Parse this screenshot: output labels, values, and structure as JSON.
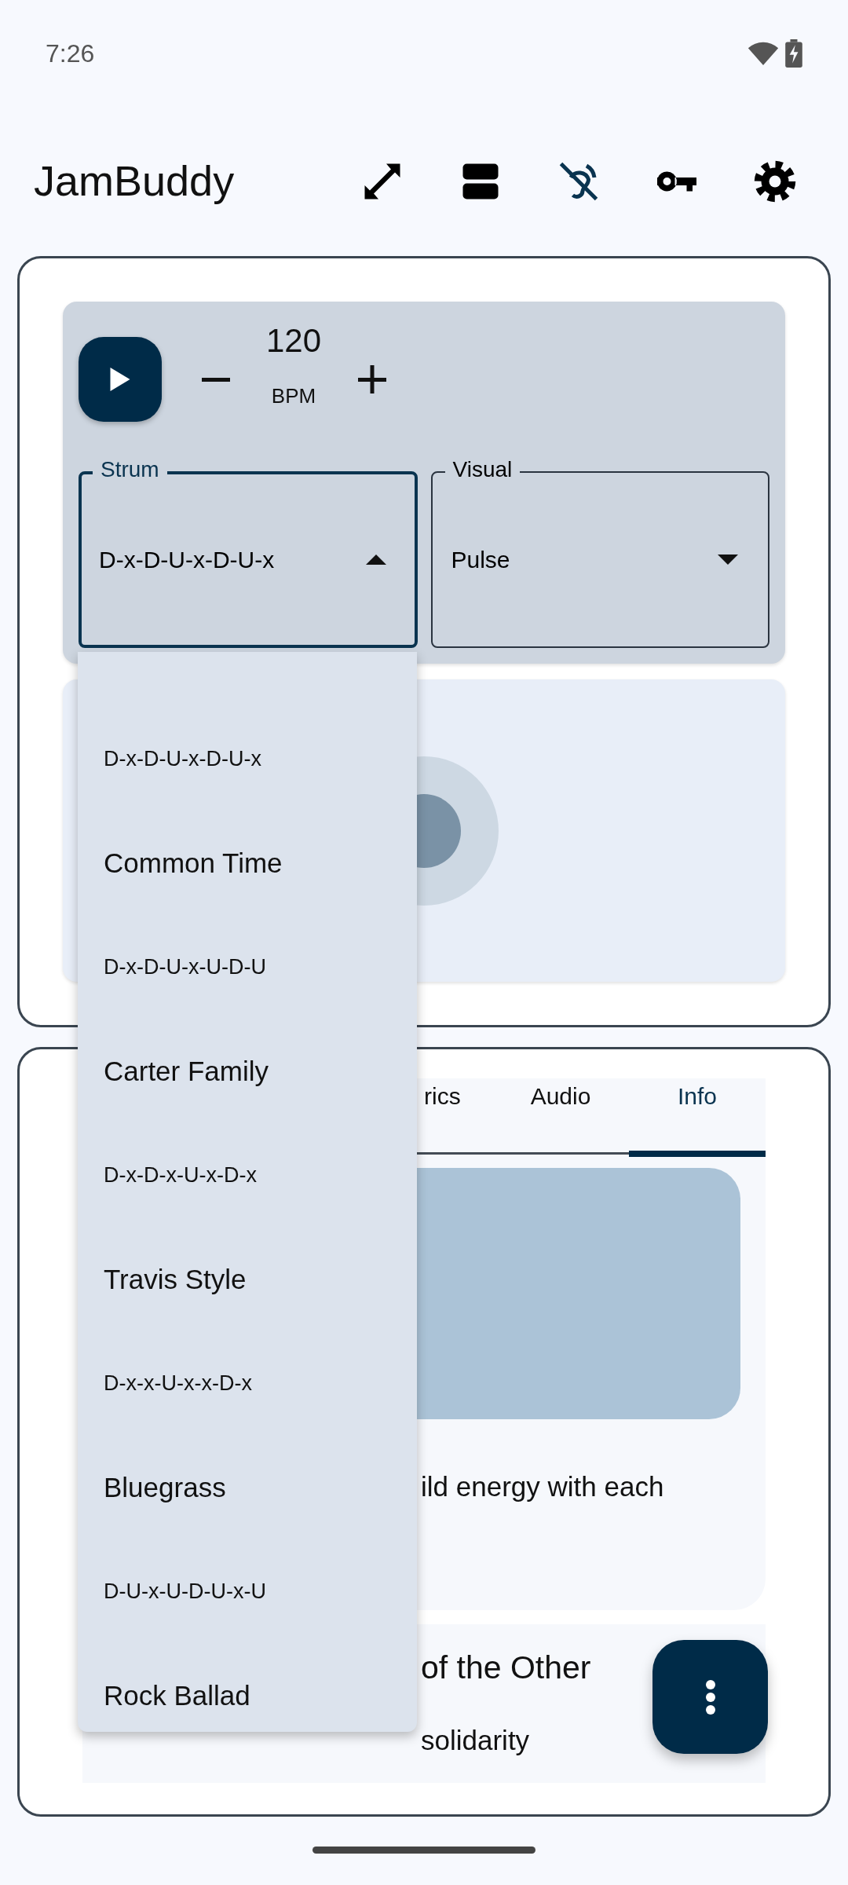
{
  "status_bar": {
    "time": "7:26"
  },
  "app_bar": {
    "title": "JamBuddy"
  },
  "player": {
    "tempo": "120",
    "tempo_unit": "BPM"
  },
  "fields": [
    {
      "label": "Strum",
      "value": "D-x-D-U-x-D-U-x",
      "expanded": true
    },
    {
      "label": "Visual",
      "value": "Pulse",
      "expanded": false
    }
  ],
  "strum_menu": {
    "items": [
      {
        "kind": "pattern",
        "text": "D-x-D-U-x-D-U-x"
      },
      {
        "kind": "name",
        "text": "Common Time"
      },
      {
        "kind": "pattern",
        "text": "D-x-D-U-x-U-D-U"
      },
      {
        "kind": "name",
        "text": "Carter Family"
      },
      {
        "kind": "pattern",
        "text": "D-x-D-x-U-x-D-x"
      },
      {
        "kind": "name",
        "text": "Travis Style"
      },
      {
        "kind": "pattern",
        "text": "D-x-x-U-x-x-D-x"
      },
      {
        "kind": "name",
        "text": "Bluegrass"
      },
      {
        "kind": "pattern",
        "text": "D-U-x-U-D-U-x-U"
      },
      {
        "kind": "name",
        "text": "Rock Ballad"
      }
    ]
  },
  "tabs": [
    {
      "label": "rics",
      "selected": false
    },
    {
      "label": "Audio",
      "selected": false
    },
    {
      "label": "Info",
      "selected": true
    }
  ],
  "info": {
    "description": "ild energy with each"
  },
  "song": {
    "title": "of the Other",
    "subtitle": "solidarity"
  }
}
